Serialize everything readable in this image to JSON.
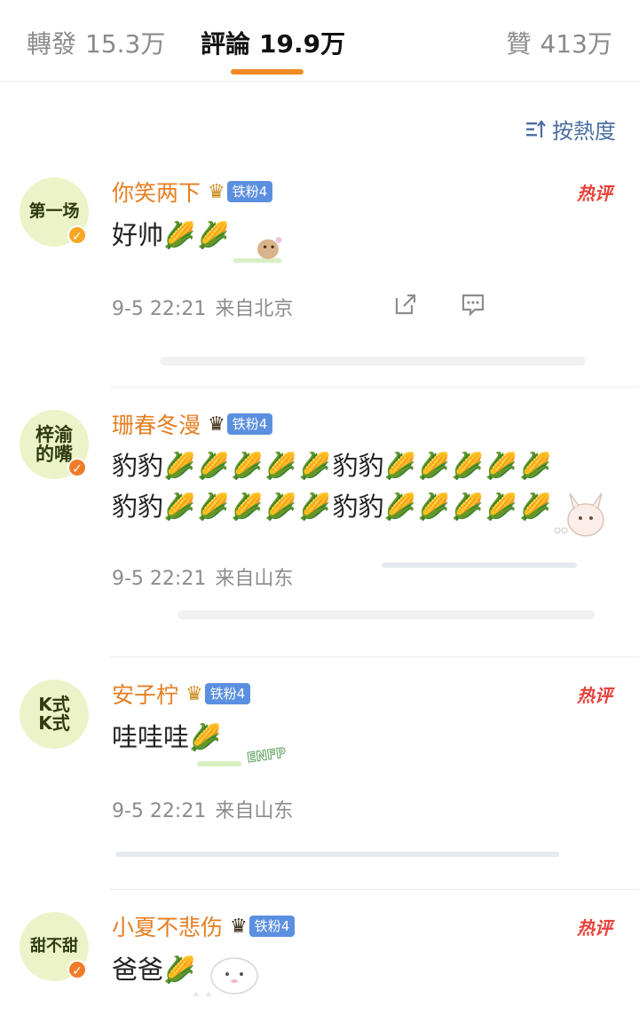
{
  "tabs": {
    "repost": {
      "label": "轉發",
      "count": "15.3万"
    },
    "comment": {
      "label": "評論",
      "count": "19.9万"
    },
    "like": {
      "label": "贊",
      "count": "413万"
    }
  },
  "sort": {
    "label": "按熱度"
  },
  "comments": [
    {
      "avatar_text": "第一场",
      "username": "你笑两下",
      "fan_badge": "铁粉4",
      "hot_label": "热评",
      "text": "好帅",
      "time": "9-5 22:21",
      "location": "来自北京"
    },
    {
      "avatar_text": "梓渝的嘴",
      "username": "珊春冬漫",
      "fan_badge": "铁粉4",
      "text_line1": "豹豹",
      "text_line1_mid": "豹豹",
      "text_line2": "豹豹",
      "text_line2_mid": "豹豹",
      "time": "9-5 22:21",
      "location": "来自山东"
    },
    {
      "avatar_text": "K式K式",
      "username": "安子柠",
      "fan_badge": "铁粉4",
      "hot_label": "热评",
      "text": "哇哇哇",
      "sticker_text": "ENFP",
      "time": "9-5 22:21",
      "location": "来自山东"
    },
    {
      "avatar_text": "甜不甜",
      "username": "小夏不悲伤",
      "fan_badge": "铁粉4",
      "hot_label": "热评",
      "text": "爸爸"
    }
  ],
  "icons": {
    "emoji": "corn",
    "crown": "crown-icon",
    "share": "share-icon",
    "reply": "comment-icon"
  },
  "colors": {
    "accent": "#f08a24",
    "username": "#e67e22",
    "hot": "#e8413a",
    "sort": "#4a6fa0",
    "fan_badge": "#5b8fe0"
  }
}
